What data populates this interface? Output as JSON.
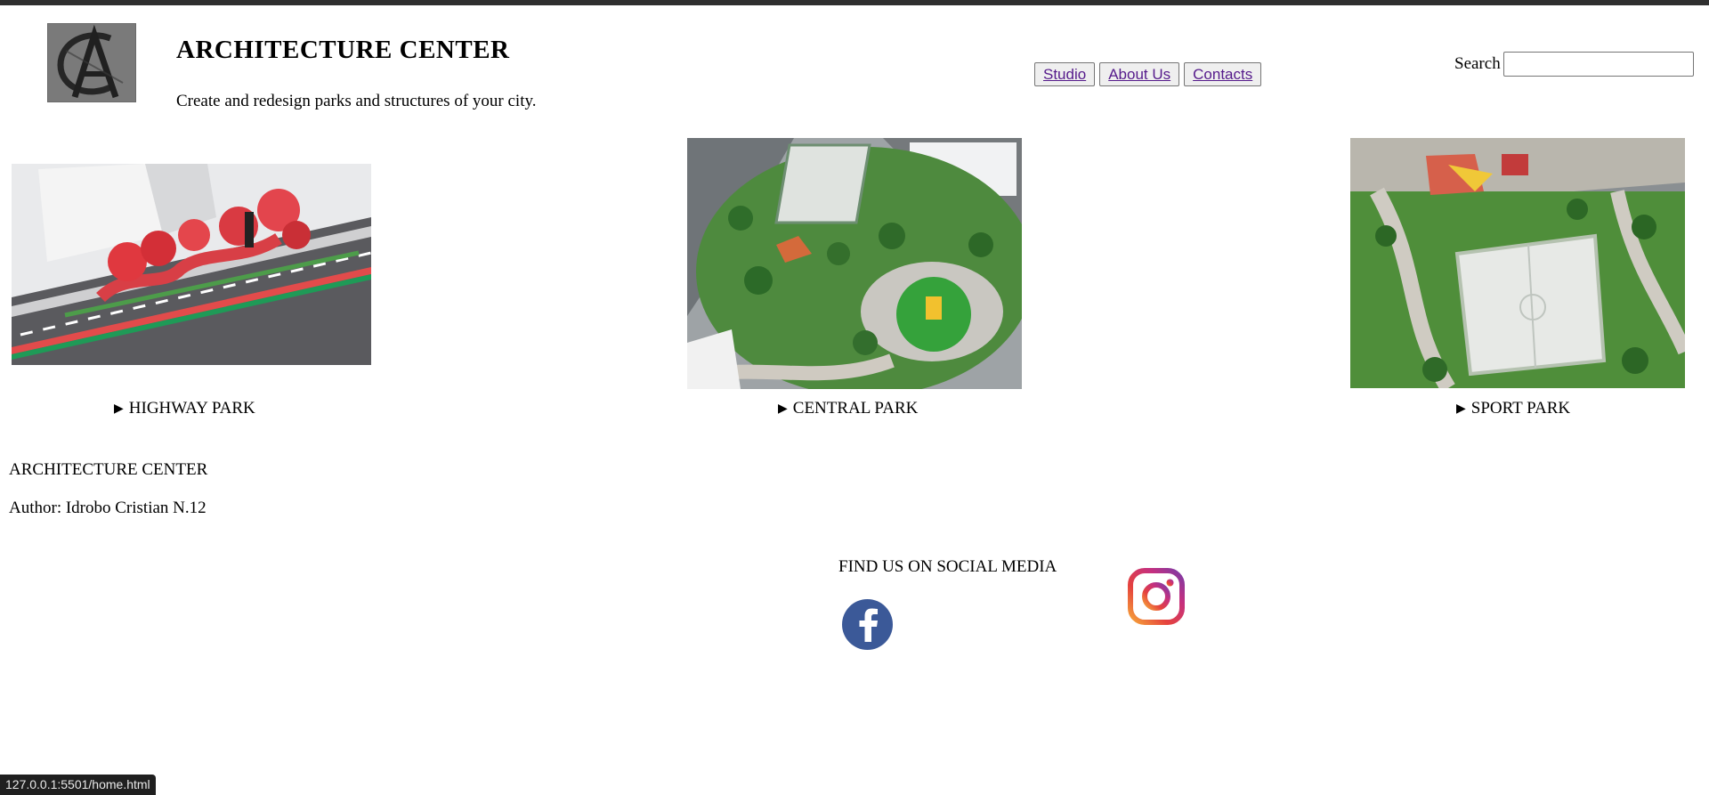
{
  "header": {
    "title": "ARCHITECTURE CENTER",
    "tagline": "Create and redesign parks and structures of your city."
  },
  "nav": {
    "items": [
      {
        "label": "Studio"
      },
      {
        "label": "About Us"
      },
      {
        "label": "Contacts"
      }
    ],
    "link_color": "#551a8b"
  },
  "search": {
    "label": "Search",
    "value": "",
    "placeholder": ""
  },
  "parks": [
    {
      "label": "HIGHWAY PARK",
      "image": "highway-park-render"
    },
    {
      "label": "CENTRAL PARK",
      "image": "central-park-render"
    },
    {
      "label": "SPORT PARK",
      "image": "sport-park-render"
    }
  ],
  "footer": {
    "title": "ARCHITECTURE CENTER",
    "author": "Author: Idrobo Cristian N.12"
  },
  "social": {
    "heading": "FIND US ON SOCIAL MEDIA",
    "icons": [
      "facebook-icon",
      "instagram-icon"
    ],
    "facebook_color": "#3b5998"
  },
  "status_bar": {
    "url": "127.0.0.1:5501/home.html"
  }
}
